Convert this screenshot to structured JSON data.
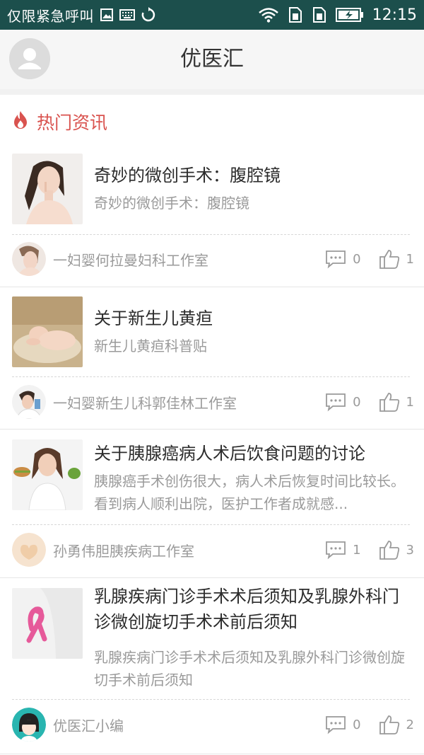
{
  "status_bar": {
    "carrier": "仅限紧急呼叫",
    "time": "12:15"
  },
  "header": {
    "title": "优医汇"
  },
  "section": {
    "title": "热门资讯",
    "accent": "#d9534f"
  },
  "articles": [
    {
      "title": "奇妙的微创手术：腹腔镜",
      "desc": "奇妙的微创手术：腹腔镜",
      "author": "一妇婴何拉曼妇科工作室",
      "comments": "0",
      "likes": "1"
    },
    {
      "title": "关于新生儿黄疸",
      "desc": "新生儿黄疸科普贴",
      "author": "一妇婴新生儿科郭佳林工作室",
      "comments": "0",
      "likes": "1"
    },
    {
      "title": "关于胰腺癌病人术后饮食问题的讨论",
      "desc": "胰腺癌手术创伤很大，病人术后恢复时间比较长。看到病人顺利出院，医护工作者成就感...",
      "author": "孙勇伟胆胰疾病工作室",
      "comments": "1",
      "likes": "3"
    },
    {
      "title": "乳腺疾病门诊手术术后须知及乳腺外科门诊微创旋切手术术前后须知",
      "desc": "乳腺疾病门诊手术术后须知及乳腺外科门诊微创旋切手术前后须知",
      "author": "优医汇小编",
      "comments": "0",
      "likes": "2"
    }
  ]
}
